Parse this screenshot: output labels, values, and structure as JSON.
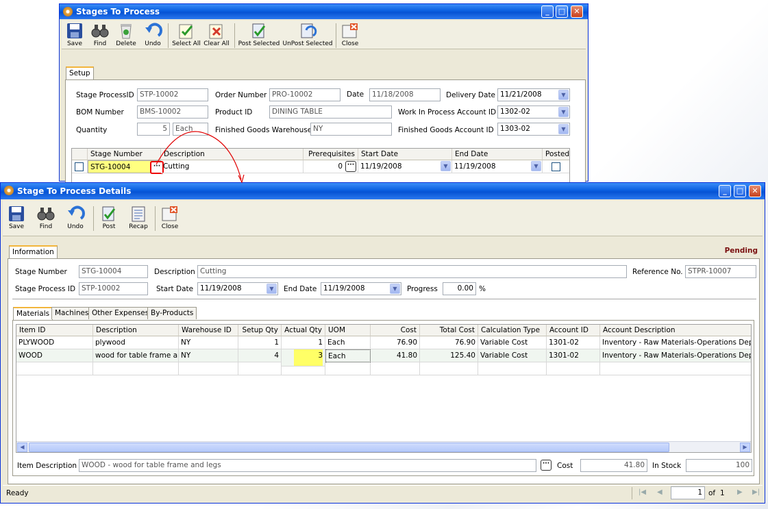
{
  "back": {
    "title": "Stages To Process",
    "toolbar": [
      "Save",
      "Find",
      "Delete",
      "Undo",
      "Select All",
      "Clear All",
      "Post Selected",
      "UnPost Selected",
      "Close"
    ],
    "tab": "Setup",
    "labels": {
      "spid": "Stage ProcessID",
      "order": "Order Number",
      "date": "Date",
      "delivery": "Delivery Date",
      "bom": "BOM Number",
      "product": "Product ID",
      "wip": "Work In Process Account ID",
      "qty": "Quantity",
      "fgw": "Finished Goods Warehouse",
      "fga": "Finished Goods Account ID"
    },
    "values": {
      "spid": "STP-10002",
      "order": "PRO-10002",
      "date": "11/18/2008",
      "delivery": "11/21/2008",
      "bom": "BMS-10002",
      "product": "DINING TABLE",
      "wip": "1302-02",
      "qty": "5",
      "uom": "Each",
      "fgw": "NY",
      "fga": "1303-02"
    },
    "grid": {
      "headers": [
        "Stage Number",
        "Description",
        "Prerequisites",
        "Start Date",
        "End Date",
        "Posted"
      ],
      "row": {
        "stage": "STG-10004",
        "desc": "Cutting",
        "prereq": "0",
        "start": "11/19/2008",
        "end": "11/19/2008"
      }
    }
  },
  "front": {
    "title": "Stage To Process Details",
    "toolbar": [
      "Save",
      "Find",
      "Undo",
      "Post",
      "Recap",
      "Close"
    ],
    "tab": "Information",
    "status_badge": "Pending",
    "labels": {
      "stage": "Stage Number",
      "desc": "Description",
      "ref": "Reference No.",
      "spid": "Stage Process ID",
      "start": "Start Date",
      "end": "End Date",
      "progress": "Progress",
      "pct": "%"
    },
    "values": {
      "stage": "STG-10004",
      "desc": "Cutting",
      "ref": "STPR-10007",
      "spid": "STP-10002",
      "start": "11/19/2008",
      "end": "11/19/2008",
      "progress": "0.00"
    },
    "subtabs": [
      "Materials",
      "Machines",
      "Other Expenses",
      "By-Products"
    ],
    "grid": {
      "headers": [
        "Item ID",
        "Description",
        "Warehouse ID",
        "Setup Qty",
        "Actual Qty",
        "UOM",
        "Cost",
        "Total Cost",
        "Calculation Type",
        "Account ID",
        "Account Description"
      ],
      "rows": [
        [
          "PLYWOOD",
          "plywood",
          "NY",
          "1",
          "1",
          "Each",
          "76.90",
          "76.90",
          "Variable Cost",
          "1301-02",
          "Inventory - Raw Materials-Operations Depar"
        ],
        [
          "WOOD",
          "wood for table frame and",
          "NY",
          "4",
          "3",
          "Each",
          "41.80",
          "125.40",
          "Variable Cost",
          "1301-02",
          "Inventory - Raw Materials-Operations Depar"
        ]
      ]
    },
    "footer": {
      "item_desc_label": "Item Description",
      "item_desc": "WOOD - wood for table frame and legs",
      "cost_label": "Cost",
      "cost": "41.80",
      "stock_label": "In Stock",
      "stock": "100"
    },
    "statusbar": {
      "text": "Ready",
      "page": "1",
      "of": "of",
      "total": "1"
    }
  }
}
